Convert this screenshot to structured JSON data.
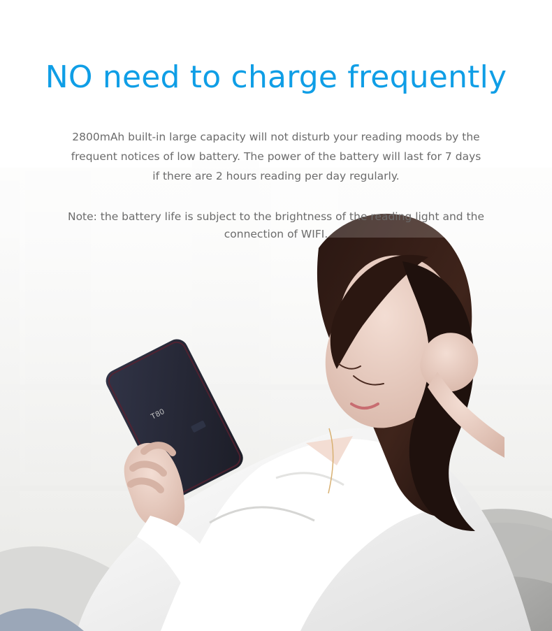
{
  "header": {
    "title": "NO need to charge frequently"
  },
  "content": {
    "paragraph_1": "2800mAh built-in large capacity will not disturb your reading moods by the frequent notices of low battery. The power of the battery will last for 7 days if there are 2 hours reading per day regularly.",
    "paragraph_2": "Note: the battery life is subject to the brightness of the reading light and the connection of WIFI."
  },
  "visuals": {
    "accent_color": "#0f9ee6",
    "body_text_color": "#6b6b6b",
    "tablet_label": "T80",
    "photo_subject": "woman-reading-tablet"
  }
}
